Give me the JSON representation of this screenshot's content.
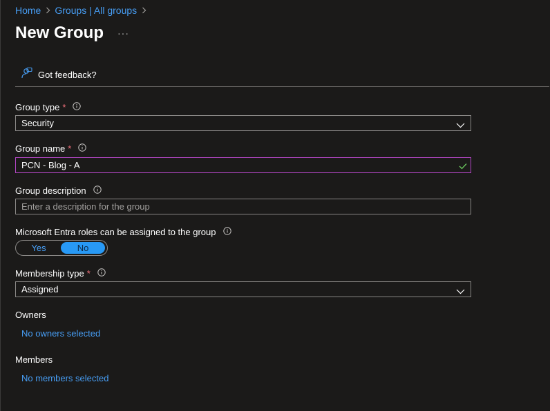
{
  "breadcrumb": {
    "home": "Home",
    "groups": "Groups | All groups"
  },
  "page": {
    "title": "New Group",
    "more": "···"
  },
  "toolbar": {
    "feedback_label": "Got feedback?"
  },
  "form": {
    "group_type": {
      "label": "Group type",
      "required": "*",
      "value": "Security"
    },
    "group_name": {
      "label": "Group name",
      "required": "*",
      "value": "PCN - Blog - A"
    },
    "group_description": {
      "label": "Group description",
      "placeholder": "Enter a description for the group"
    },
    "entra_roles": {
      "label": "Microsoft Entra roles can be assigned to the group",
      "yes": "Yes",
      "no": "No",
      "selected": "No"
    },
    "membership_type": {
      "label": "Membership type",
      "required": "*",
      "value": "Assigned"
    },
    "owners": {
      "label": "Owners",
      "link": "No owners selected"
    },
    "members": {
      "label": "Members",
      "link": "No members selected"
    }
  },
  "colors": {
    "background": "#1b1a19",
    "link": "#479ef5",
    "required": "#f1707b",
    "focus_border": "#b146c2",
    "toggle_on": "#2899f5",
    "valid": "#6ccb5f"
  }
}
